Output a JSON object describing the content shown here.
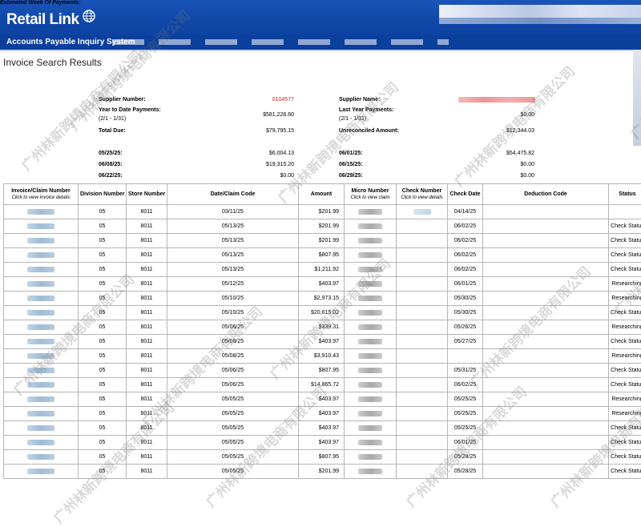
{
  "header": {
    "logo_text": "Retail Link",
    "system_title": "Accounts Payable Inquiry System"
  },
  "page": {
    "title": "Invoice Search Results"
  },
  "summary": {
    "supplier_number_label": "Supplier Number:",
    "supplier_number_value": "0104577",
    "ytd_label": "Year to Date Payments:",
    "ytd_sub": "(2/1 - 1/31)",
    "ytd_value": "$581,228.60",
    "total_due_label": "Total Due:",
    "total_due_value": "$79,795.15",
    "supplier_name_label": "Supplier Name:",
    "last_year_label": "Last Year Payments:",
    "last_year_sub": "(2/1 - 1/31)",
    "last_year_value": "$0.00",
    "unreconciled_label": "Unreconciled Amount:",
    "unreconciled_value": "$12,344.03",
    "estimated_label": "Estimated Week Of Payments:",
    "weeks": [
      {
        "left_date": "05/25/25:",
        "left_value": "$6,004.13",
        "right_date": "06/01/25:",
        "right_value": "$54,475.82"
      },
      {
        "left_date": "06/08/25:",
        "left_value": "$19,315.20",
        "right_date": "06/15/25:",
        "right_value": "$0.00"
      },
      {
        "left_date": "06/22/25:",
        "left_value": "$0.00",
        "right_date": "06/29/25:",
        "right_value": "$0.00"
      }
    ]
  },
  "table": {
    "headers": {
      "invoice": "Invoice/Claim Number",
      "invoice_sub": "Click to view invoice details",
      "division": "Division Number",
      "store": "Store Number",
      "date": "Date/Claim Code",
      "amount": "Amount",
      "micro": "Micro Number",
      "micro_sub": "Click to view claim",
      "check_number": "Check Number",
      "check_number_sub": "Click to view details",
      "check_date": "Check Date",
      "deduction": "Deduction Code",
      "status": "Status"
    },
    "rows": [
      {
        "division": "05",
        "store": "8011",
        "date": "03/11/25",
        "amount": "$201.99",
        "check_date": "04/14/25",
        "status": "",
        "has_check": true
      },
      {
        "division": "05",
        "store": "8011",
        "date": "05/13/25",
        "amount": "$201.99",
        "check_date": "06/02/25",
        "status": "Check Status",
        "has_check": false
      },
      {
        "division": "05",
        "store": "8011",
        "date": "05/13/25",
        "amount": "$201.99",
        "check_date": "06/02/25",
        "status": "Check Status",
        "has_check": false
      },
      {
        "division": "05",
        "store": "8011",
        "date": "05/13/25",
        "amount": "$807.95",
        "check_date": "06/02/25",
        "status": "Check Status",
        "has_check": false
      },
      {
        "division": "05",
        "store": "8011",
        "date": "05/13/25",
        "amount": "$1,211.92",
        "check_date": "06/02/25",
        "status": "Check Status",
        "has_check": false
      },
      {
        "division": "05",
        "store": "8011",
        "date": "05/12/25",
        "amount": "$403.97",
        "check_date": "06/01/25",
        "status": "Researching",
        "has_check": false
      },
      {
        "division": "05",
        "store": "8011",
        "date": "05/10/25",
        "amount": "$2,973.15",
        "check_date": "05/30/25",
        "status": "Researching",
        "has_check": false
      },
      {
        "division": "05",
        "store": "8011",
        "date": "05/10/25",
        "amount": "$20,615.02",
        "check_date": "05/30/25",
        "status": "Check Status",
        "has_check": false
      },
      {
        "division": "05",
        "store": "8011",
        "date": "05/06/25",
        "amount": "$339.31",
        "check_date": "05/26/25",
        "status": "Researching",
        "has_check": false
      },
      {
        "division": "05",
        "store": "8011",
        "date": "05/08/25",
        "amount": "$403.97",
        "check_date": "05/27/25",
        "status": "Check Status",
        "has_check": false
      },
      {
        "division": "05",
        "store": "8011",
        "date": "05/08/25",
        "amount": "$3,910.43",
        "check_date": "",
        "status": "Researching",
        "has_check": false
      },
      {
        "division": "05",
        "store": "8011",
        "date": "05/06/25",
        "amount": "$807.95",
        "check_date": "05/31/25",
        "status": "Check Status",
        "has_check": false
      },
      {
        "division": "05",
        "store": "8011",
        "date": "05/06/25",
        "amount": "$14,865.72",
        "check_date": "06/02/25",
        "status": "Check Status",
        "has_check": false
      },
      {
        "division": "05",
        "store": "8011",
        "date": "05/05/25",
        "amount": "$403.97",
        "check_date": "05/25/25",
        "status": "Researching",
        "has_check": false
      },
      {
        "division": "05",
        "store": "8011",
        "date": "05/05/25",
        "amount": "$403.97",
        "check_date": "05/25/25",
        "status": "Researching",
        "has_check": false
      },
      {
        "division": "05",
        "store": "8011",
        "date": "05/05/25",
        "amount": "$403.97",
        "check_date": "05/25/25",
        "status": "Check Status",
        "has_check": false
      },
      {
        "division": "05",
        "store": "8011",
        "date": "05/05/25",
        "amount": "$403.97",
        "check_date": "06/01/25",
        "status": "Check Status",
        "has_check": false
      },
      {
        "division": "05",
        "store": "8011",
        "date": "05/05/25",
        "amount": "$807.95",
        "check_date": "05/28/25",
        "status": "Check Status",
        "has_check": false
      },
      {
        "division": "05",
        "store": "8011",
        "date": "05/05/25",
        "amount": "$201.99",
        "check_date": "05/28/25",
        "status": "Check Status",
        "has_check": false
      }
    ]
  },
  "watermark_text": "广州林新跨境电商有限公司",
  "colors": {
    "header_blue": "#0f47a8",
    "supplier_number_red": "#c0292f"
  }
}
